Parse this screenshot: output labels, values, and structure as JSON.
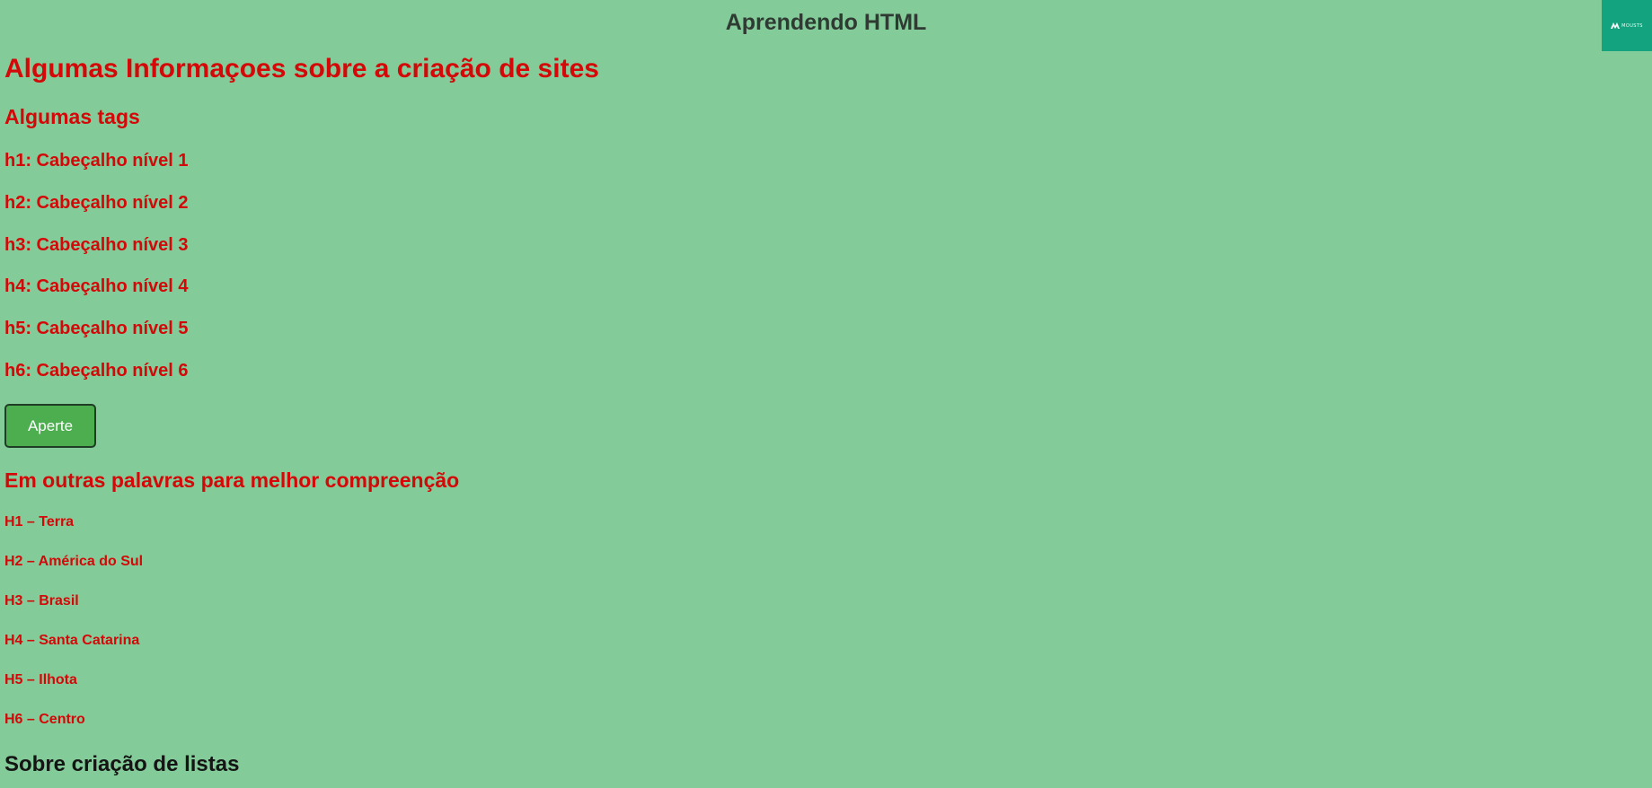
{
  "header": {
    "title": "Aprendendo HTML",
    "badge_text": "MOUSTS",
    "badge_color": "#13a37f"
  },
  "main": {
    "heading": "Algumas Informaçoes sobre a criação de sites",
    "tags_heading": "Algumas tags",
    "tags": [
      "h1: Cabeçalho nível 1",
      "h2: Cabeçalho nível 2",
      "h3: Cabeçalho nível 3",
      "h4: Cabeçalho nível 4",
      "h5: Cabeçalho nível 5",
      "h6: Cabeçalho nível 6"
    ],
    "button_label": "Aperte",
    "explain_heading": "Em outras palavras para melhor compreenção",
    "geo": [
      "H1 – Terra",
      "H2 – América do Sul",
      "H3 – Brasil",
      "H4 – Santa Catarina",
      "H5 – Ilhota",
      "H6 – Centro"
    ],
    "lists_heading": "Sobre criação de listas"
  },
  "colors": {
    "background": "#83cb98",
    "heading_red": "#d40808",
    "button_green": "#4cae4f"
  }
}
